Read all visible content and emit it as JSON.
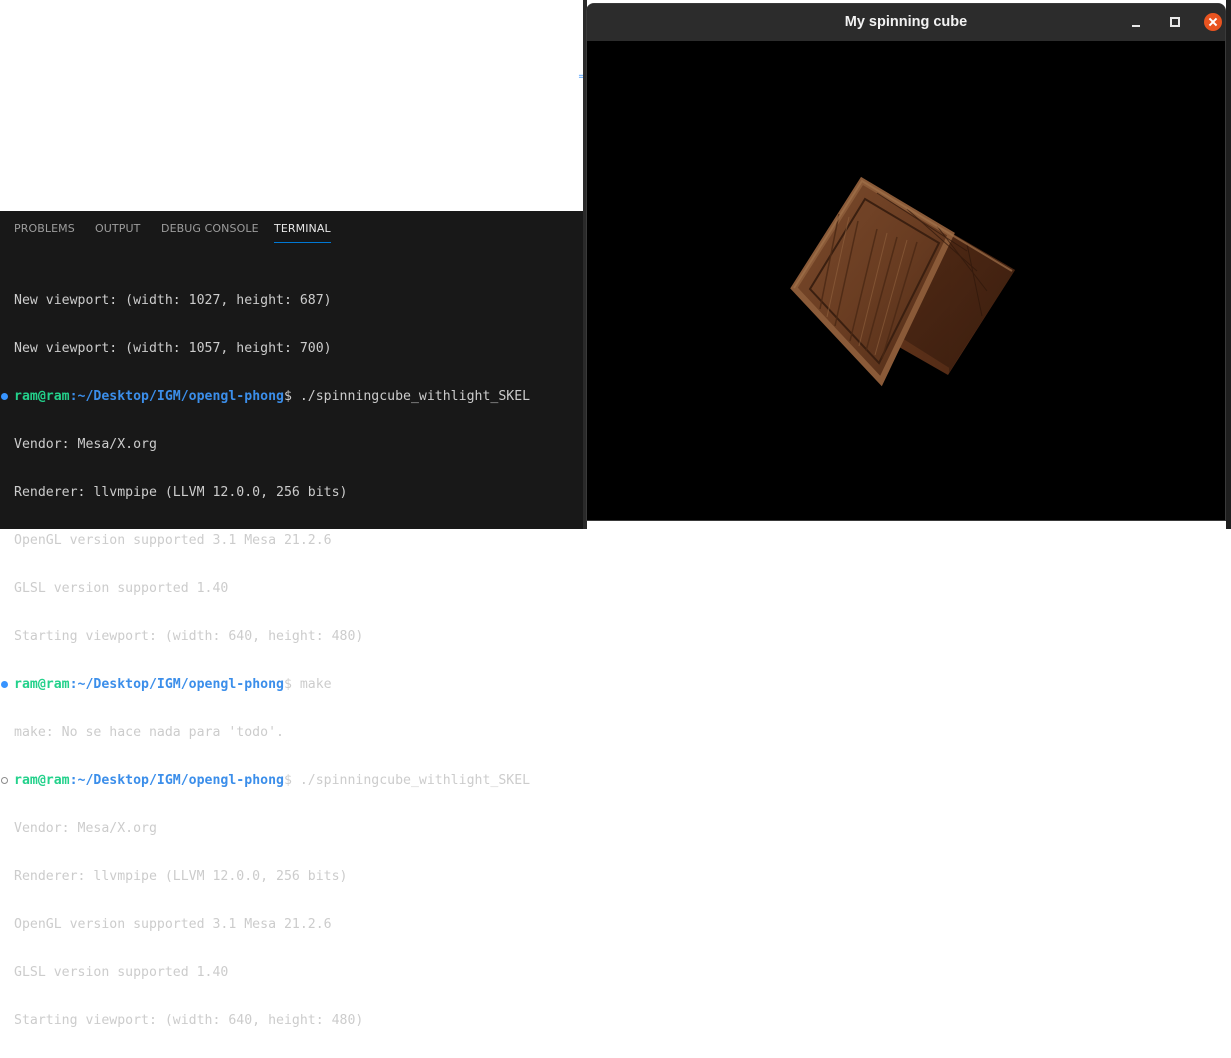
{
  "panel": {
    "tabs": [
      {
        "label": "PROBLEMS"
      },
      {
        "label": "OUTPUT"
      },
      {
        "label": "DEBUG CONSOLE"
      },
      {
        "label": "TERMINAL"
      }
    ],
    "active_tab": "TERMINAL"
  },
  "terminal": {
    "user_host": "ram@ram",
    "path": ":~/Desktop/IGM/opengl-phong",
    "lines": [
      "New viewport: (width: 1027, height: 687)",
      "New viewport: (width: 1057, height: 700)",
      "$ ./spinningcube_withlight_SKEL",
      "Vendor: Mesa/X.org",
      "Renderer: llvmpipe (LLVM 12.0.0, 256 bits)",
      "OpenGL version supported 3.1 Mesa 21.2.6",
      "GLSL version supported 1.40",
      "Starting viewport: (width: 640, height: 480)",
      "$ make",
      "make: No se hace nada para 'todo'.",
      "$ ./spinningcube_withlight_SKEL",
      "Vendor: Mesa/X.org",
      "Renderer: llvmpipe (LLVM 12.0.0, 256 bits)",
      "OpenGL version supported 3.1 Mesa 21.2.6",
      "GLSL version supported 1.40",
      "Starting viewport: (width: 640, height: 480)"
    ]
  },
  "window": {
    "title": "My spinning cube"
  },
  "colors": {
    "terminal_bg": "#181818",
    "prompt_user": "#23d18b",
    "prompt_path": "#3b8eea",
    "close_button": "#e95420"
  }
}
